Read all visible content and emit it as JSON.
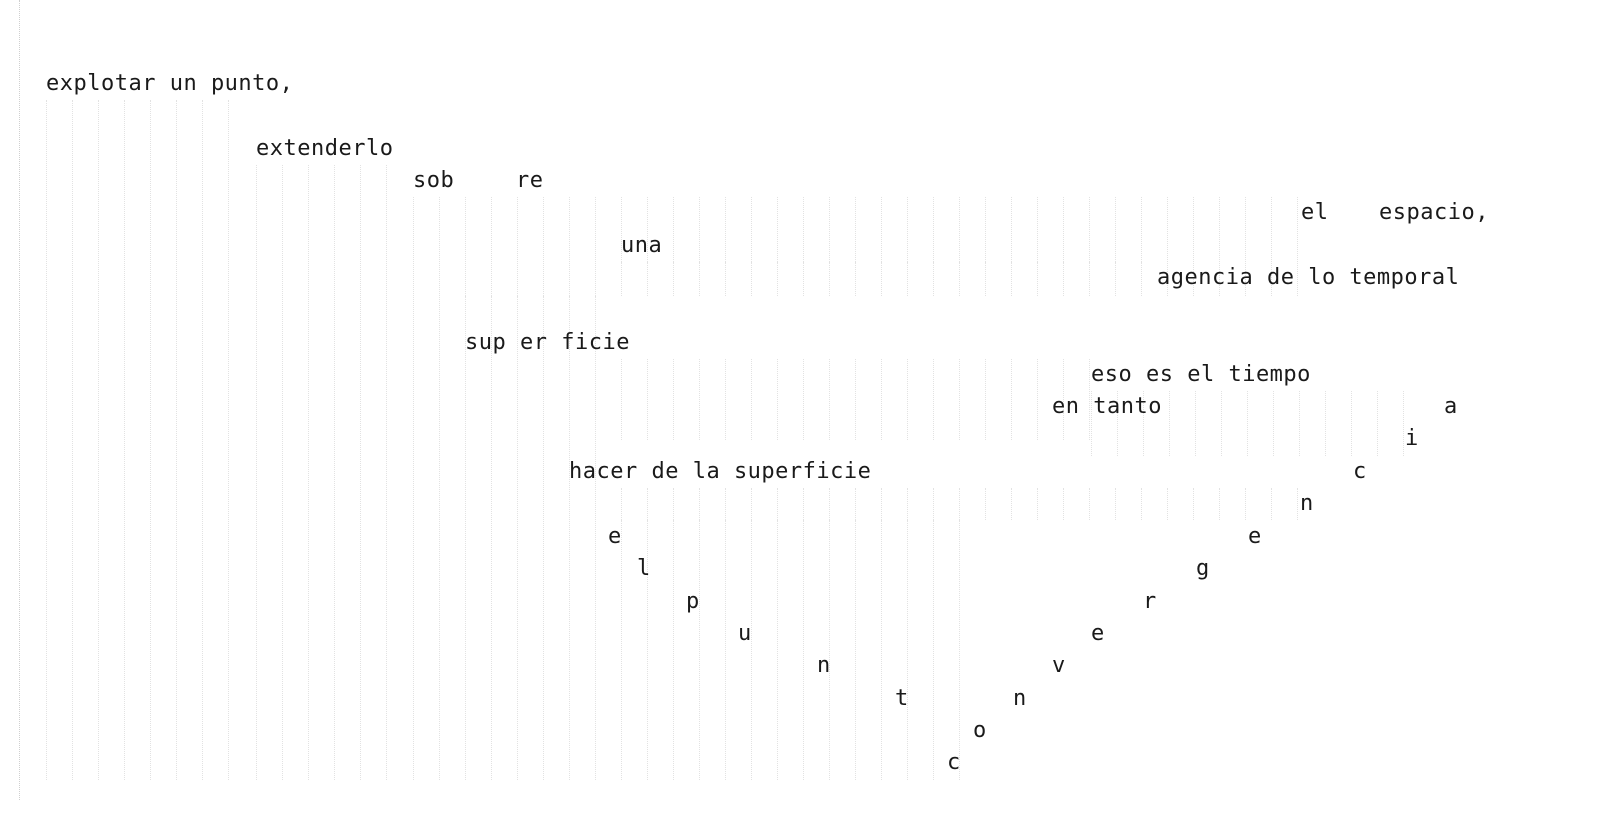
{
  "poem": {
    "lines": [
      [
        "explotar un punto,"
      ],
      [
        "extenderlo"
      ],
      [
        "sob",
        "re"
      ],
      [
        "el",
        "espacio,"
      ],
      [
        "una"
      ],
      [
        "agencia de lo temporal"
      ],
      [
        "sup er ficie"
      ],
      [
        "eso es el tiempo"
      ],
      [
        "en tanto",
        "a"
      ],
      [
        "i"
      ],
      [
        "hacer de la superficie",
        "c"
      ],
      [
        "n"
      ],
      [
        "e",
        "e"
      ],
      [
        "l",
        "g"
      ],
      [
        "p",
        "r"
      ],
      [
        "u",
        "e"
      ],
      [
        "n",
        "v"
      ],
      [
        "t",
        "n"
      ],
      [
        "o"
      ],
      [
        "c"
      ]
    ]
  }
}
